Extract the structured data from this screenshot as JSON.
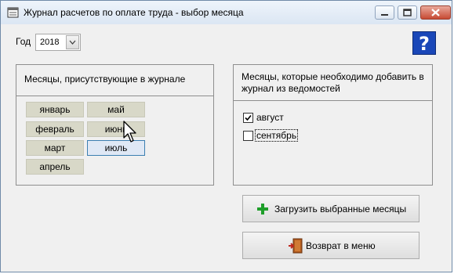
{
  "window": {
    "title": "Журнал расчетов по оплате труда - выбор месяца"
  },
  "year": {
    "label": "Год",
    "value": "2018"
  },
  "help": {
    "symbol": "?"
  },
  "journal_months": {
    "title": "Месяцы, присутствующие в журнале",
    "items": [
      "январь",
      "февраль",
      "март",
      "апрель",
      "май",
      "июнь",
      "июль"
    ]
  },
  "add_months": {
    "title": "Месяцы, которые необходимо добавить в журнал из ведомостей",
    "items": [
      {
        "label": "август",
        "checked": true
      },
      {
        "label": "сентябрь",
        "checked": false
      }
    ]
  },
  "actions": {
    "load_label": "Загрузить выбранные месяцы",
    "return_label": "Возврат в меню"
  }
}
